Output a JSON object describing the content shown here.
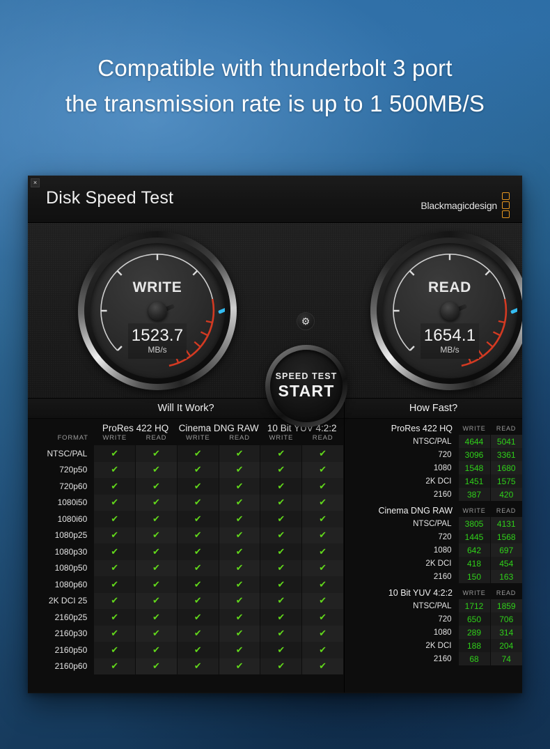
{
  "headline": {
    "line1": "Compatible with thunderbolt 3 port",
    "line2": "the transmission rate is up to 1 500MB/S"
  },
  "window": {
    "close_label": "×",
    "app_title": "Disk Speed Test",
    "brand_text": "Blackmagicdesign"
  },
  "gauges": {
    "write": {
      "label": "WRITE",
      "value": "1523.7",
      "unit": "MB/s",
      "needle_angle": -203
    },
    "read": {
      "label": "READ",
      "value": "1654.1",
      "unit": "MB/s",
      "needle_angle": -203
    },
    "gear_icon": "gear-icon",
    "start": {
      "top_label": "SPEED TEST",
      "main_label": "START"
    }
  },
  "will_it_work": {
    "title": "Will It Work?",
    "format_header": "FORMAT",
    "codecs": [
      "ProRes 422 HQ",
      "Cinema DNG RAW",
      "10 Bit YUV 4:2:2"
    ],
    "sub_headers": [
      "WRITE",
      "READ"
    ],
    "check_glyph": "✔",
    "rows": [
      {
        "format": "NTSC/PAL",
        "checks": [
          true,
          true,
          true,
          true,
          true,
          true
        ]
      },
      {
        "format": "720p50",
        "checks": [
          true,
          true,
          true,
          true,
          true,
          true
        ]
      },
      {
        "format": "720p60",
        "checks": [
          true,
          true,
          true,
          true,
          true,
          true
        ]
      },
      {
        "format": "1080i50",
        "checks": [
          true,
          true,
          true,
          true,
          true,
          true
        ]
      },
      {
        "format": "1080i60",
        "checks": [
          true,
          true,
          true,
          true,
          true,
          true
        ]
      },
      {
        "format": "1080p25",
        "checks": [
          true,
          true,
          true,
          true,
          true,
          true
        ]
      },
      {
        "format": "1080p30",
        "checks": [
          true,
          true,
          true,
          true,
          true,
          true
        ]
      },
      {
        "format": "1080p50",
        "checks": [
          true,
          true,
          true,
          true,
          true,
          true
        ]
      },
      {
        "format": "1080p60",
        "checks": [
          true,
          true,
          true,
          true,
          true,
          true
        ]
      },
      {
        "format": "2K DCI 25",
        "checks": [
          true,
          true,
          true,
          true,
          true,
          true
        ]
      },
      {
        "format": "2160p25",
        "checks": [
          true,
          true,
          true,
          true,
          true,
          true
        ]
      },
      {
        "format": "2160p30",
        "checks": [
          true,
          true,
          true,
          true,
          true,
          true
        ]
      },
      {
        "format": "2160p50",
        "checks": [
          true,
          true,
          true,
          true,
          true,
          true
        ]
      },
      {
        "format": "2160p60",
        "checks": [
          true,
          true,
          true,
          true,
          true,
          true
        ]
      }
    ]
  },
  "how_fast": {
    "title": "How Fast?",
    "sub_headers": [
      "WRITE",
      "READ"
    ],
    "sections": [
      {
        "name": "ProRes 422 HQ",
        "rows": [
          {
            "label": "NTSC/PAL",
            "write": "4644",
            "read": "5041"
          },
          {
            "label": "720",
            "write": "3096",
            "read": "3361"
          },
          {
            "label": "1080",
            "write": "1548",
            "read": "1680"
          },
          {
            "label": "2K DCI",
            "write": "1451",
            "read": "1575"
          },
          {
            "label": "2160",
            "write": "387",
            "read": "420"
          }
        ]
      },
      {
        "name": "Cinema DNG RAW",
        "rows": [
          {
            "label": "NTSC/PAL",
            "write": "3805",
            "read": "4131"
          },
          {
            "label": "720",
            "write": "1445",
            "read": "1568"
          },
          {
            "label": "1080",
            "write": "642",
            "read": "697"
          },
          {
            "label": "2K DCI",
            "write": "418",
            "read": "454"
          },
          {
            "label": "2160",
            "write": "150",
            "read": "163"
          }
        ]
      },
      {
        "name": "10 Bit YUV 4:2:2",
        "rows": [
          {
            "label": "NTSC/PAL",
            "write": "1712",
            "read": "1859"
          },
          {
            "label": "720",
            "write": "650",
            "read": "706"
          },
          {
            "label": "1080",
            "write": "289",
            "read": "314"
          },
          {
            "label": "2K DCI",
            "write": "188",
            "read": "204"
          },
          {
            "label": "2160",
            "write": "68",
            "read": "74"
          }
        ]
      }
    ]
  },
  "colors": {
    "accent_blue": "#2bb5ec",
    "check_green": "#62d81b",
    "value_green": "#2fd119",
    "brand_orange": "#e8971f",
    "redzone": "#d33a22"
  }
}
